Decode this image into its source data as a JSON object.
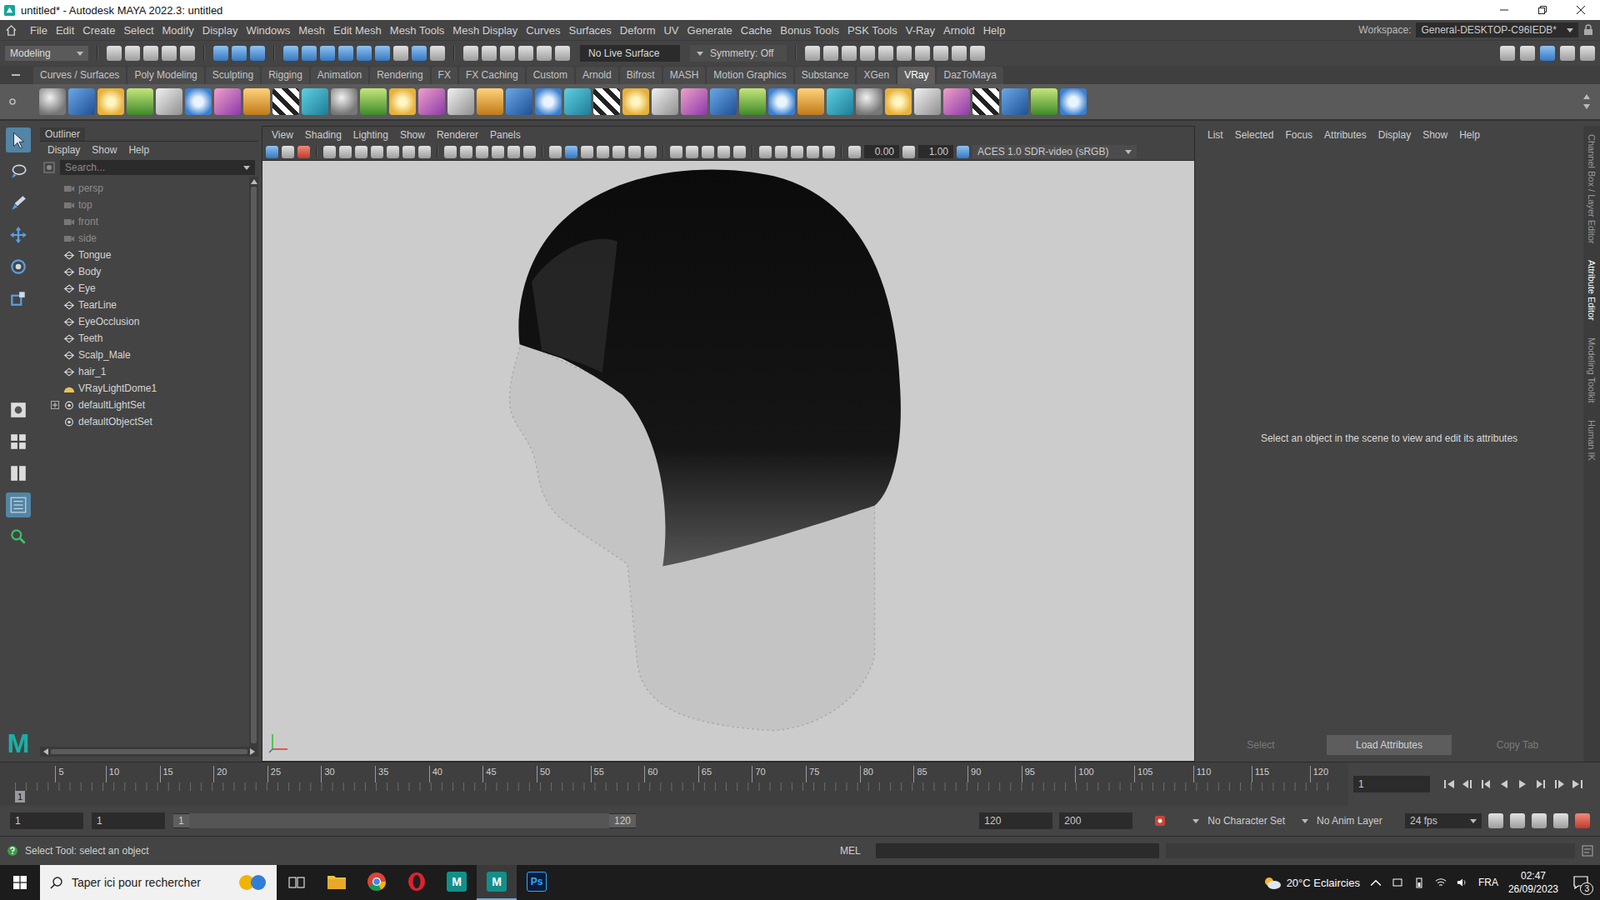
{
  "window": {
    "title": "untitled* - Autodesk MAYA 2022.3: untitled"
  },
  "menubar": {
    "items": [
      "File",
      "Edit",
      "Create",
      "Select",
      "Modify",
      "Display",
      "Windows",
      "Mesh",
      "Edit Mesh",
      "Mesh Tools",
      "Mesh Display",
      "Curves",
      "Surfaces",
      "Deform",
      "UV",
      "Generate",
      "Cache",
      "Bonus Tools",
      "PSK Tools",
      "V-Ray",
      "Arnold",
      "Help"
    ],
    "workspace_label": "Workspace:",
    "workspace": "General-DESKTOP-C96IEDB*"
  },
  "statusline": {
    "mode": "Modeling",
    "live_surface": "No Live Surface",
    "symmetry": "Symmetry: Off"
  },
  "shelf": {
    "tabs": [
      {
        "label": "Curves / Surfaces",
        "selected": false
      },
      {
        "label": "Poly Modeling",
        "selected": false
      },
      {
        "label": "Sculpting",
        "selected": false
      },
      {
        "label": "Rigging",
        "selected": false
      },
      {
        "label": "Animation",
        "selected": false
      },
      {
        "label": "Rendering",
        "selected": false
      },
      {
        "label": "FX",
        "selected": false
      },
      {
        "label": "FX Caching",
        "selected": false
      },
      {
        "label": "Custom",
        "selected": false
      },
      {
        "label": "Arnold",
        "selected": false
      },
      {
        "label": "Bifrost",
        "selected": false
      },
      {
        "label": "MASH",
        "selected": false
      },
      {
        "label": "Motion Graphics",
        "selected": false
      },
      {
        "label": "Substance",
        "selected": false
      },
      {
        "label": "XGen",
        "selected": false
      },
      {
        "label": "VRay",
        "selected": true
      },
      {
        "label": "DazToMaya",
        "selected": false
      }
    ]
  },
  "toolbox": {
    "logo": "M",
    "tools": [
      {
        "selected": true
      },
      {
        "selected": false
      },
      {
        "selected": false
      },
      {
        "selected": false
      },
      {
        "selected": false
      },
      {
        "selected": false
      }
    ]
  },
  "outliner": {
    "title": "Outliner",
    "menu": [
      "Display",
      "Show",
      "Help"
    ],
    "search_placeholder": "Search...",
    "items": [
      {
        "label": "persp",
        "kind": "camera",
        "dimmed": true,
        "expandable": false
      },
      {
        "label": "top",
        "kind": "camera",
        "dimmed": true,
        "expandable": false
      },
      {
        "label": "front",
        "kind": "camera",
        "dimmed": true,
        "expandable": false
      },
      {
        "label": "side",
        "kind": "camera",
        "dimmed": true,
        "expandable": false
      },
      {
        "label": "Tongue",
        "kind": "mesh",
        "dimmed": false,
        "expandable": false
      },
      {
        "label": "Body",
        "kind": "mesh",
        "dimmed": false,
        "expandable": false
      },
      {
        "label": "Eye",
        "kind": "mesh",
        "dimmed": false,
        "expandable": false
      },
      {
        "label": "TearLine",
        "kind": "mesh",
        "dimmed": false,
        "expandable": false
      },
      {
        "label": "EyeOcclusion",
        "kind": "mesh",
        "dimmed": false,
        "expandable": false
      },
      {
        "label": "Teeth",
        "kind": "mesh",
        "dimmed": false,
        "expandable": false
      },
      {
        "label": "Scalp_Male",
        "kind": "mesh",
        "dimmed": false,
        "expandable": false
      },
      {
        "label": "hair_1",
        "kind": "mesh",
        "dimmed": false,
        "expandable": false
      },
      {
        "label": "VRayLightDome1",
        "kind": "light",
        "dimmed": false,
        "expandable": false
      },
      {
        "label": "defaultLightSet",
        "kind": "set",
        "dimmed": false,
        "expandable": true
      },
      {
        "label": "defaultObjectSet",
        "kind": "set",
        "dimmed": false,
        "expandable": false
      }
    ]
  },
  "viewport": {
    "menu": [
      "View",
      "Shading",
      "Lighting",
      "Show",
      "Renderer",
      "Panels"
    ],
    "exposure": "0.00",
    "gamma": "1.00",
    "color_space": "ACES 1.0 SDR-video (sRGB)"
  },
  "attribute_editor": {
    "menu": [
      "List",
      "Selected",
      "Focus",
      "Attributes",
      "Display",
      "Show",
      "Help"
    ],
    "message": "Select an object in the scene to view and edit its attributes",
    "buttons": [
      {
        "label": "Select",
        "disabled": true
      },
      {
        "label": "Load Attributes",
        "disabled": false
      },
      {
        "label": "Copy Tab",
        "disabled": true
      }
    ]
  },
  "side_tabs": [
    {
      "label": "Channel Box / Layer Editor",
      "selected": false
    },
    {
      "label": "Attribute Editor",
      "selected": true
    },
    {
      "label": "Modeling Toolkit",
      "selected": false
    },
    {
      "label": "Human IK",
      "selected": false
    }
  ],
  "timeline": {
    "ticks": [
      "5",
      "10",
      "15",
      "20",
      "25",
      "30",
      "35",
      "40",
      "45",
      "50",
      "55",
      "60",
      "65",
      "70",
      "75",
      "80",
      "85",
      "90",
      "95",
      "100",
      "105",
      "110",
      "115",
      "120"
    ],
    "current_frame": "1",
    "frame_field": "1"
  },
  "range": {
    "start": "1",
    "playback_start": "1",
    "slider_start": "1",
    "slider_end": "120",
    "playback_end": "120",
    "end": "200",
    "character_set": "No Character Set",
    "anim_layer": "No Anim Layer",
    "fps": "24 fps"
  },
  "helpline": {
    "text": "Select Tool: select an object",
    "language": "MEL"
  },
  "taskbar": {
    "search_placeholder": "Taper ici pour rechercher",
    "apps": [
      {
        "kind": "explorer",
        "glyph": "",
        "active": false
      },
      {
        "kind": "chrome",
        "glyph": "",
        "active": false
      },
      {
        "kind": "opera",
        "glyph": "",
        "active": false
      },
      {
        "kind": "maya",
        "glyph": "M",
        "active": false
      },
      {
        "kind": "maya",
        "glyph": "M",
        "active": true
      },
      {
        "kind": "photoshop",
        "glyph": "Ps",
        "active": false
      }
    ],
    "weather": "20°C Eclaircies",
    "language": "FRA",
    "time": "02:47",
    "date": "26/09/2023",
    "notifications": "3"
  }
}
